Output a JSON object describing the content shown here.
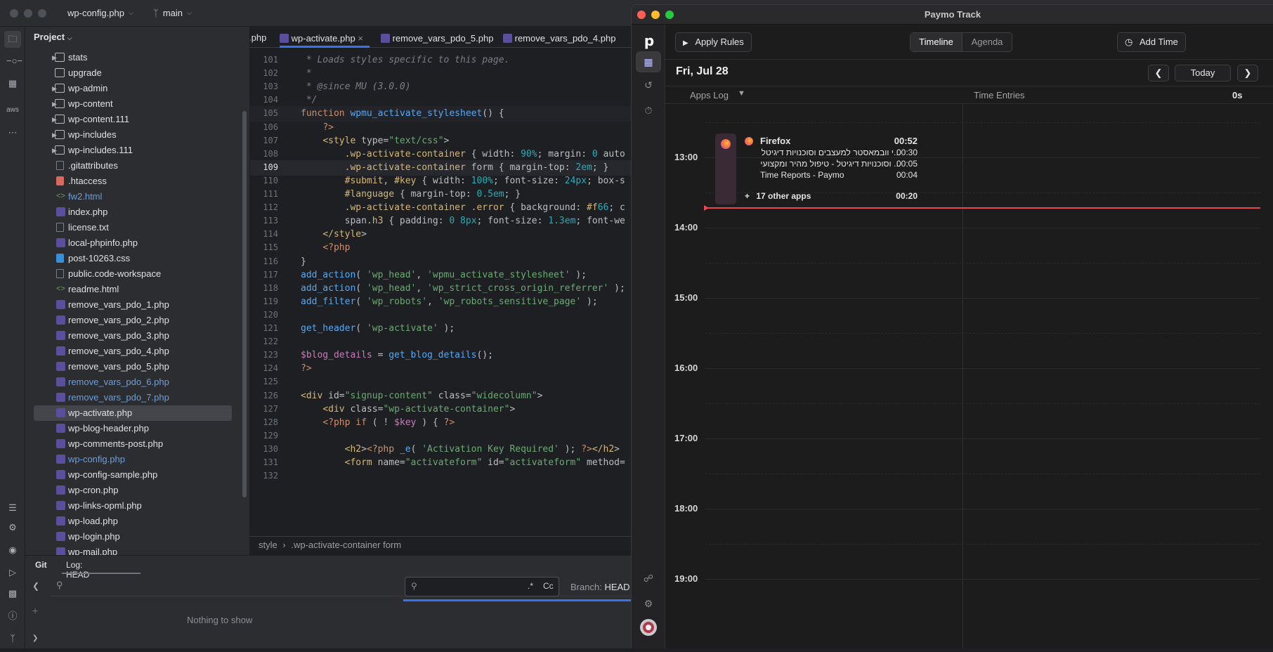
{
  "ide": {
    "window": {
      "file_title": "wp-config.php",
      "branch": "main"
    },
    "project_panel": {
      "title": "Project",
      "items": [
        {
          "label": "stats",
          "type": "folder",
          "expandable": true,
          "color": "normal"
        },
        {
          "label": "upgrade",
          "type": "folder",
          "expandable": false,
          "color": "normal"
        },
        {
          "label": "wp-admin",
          "type": "folder",
          "expandable": true,
          "color": "normal"
        },
        {
          "label": "wp-content",
          "type": "folder",
          "expandable": true,
          "color": "normal"
        },
        {
          "label": "wp-content.111",
          "type": "folder",
          "expandable": true,
          "color": "normal"
        },
        {
          "label": "wp-includes",
          "type": "folder",
          "expandable": true,
          "color": "normal"
        },
        {
          "label": "wp-includes.111",
          "type": "folder",
          "expandable": true,
          "color": "normal"
        },
        {
          "label": ".gitattributes",
          "type": "file",
          "color": "normal"
        },
        {
          "label": ".htaccess",
          "type": "git",
          "color": "normal"
        },
        {
          "label": "fw2.html",
          "type": "html",
          "color": "modified"
        },
        {
          "label": "index.php",
          "type": "php",
          "color": "normal"
        },
        {
          "label": "license.txt",
          "type": "file",
          "color": "normal"
        },
        {
          "label": "local-phpinfo.php",
          "type": "php",
          "color": "normal"
        },
        {
          "label": "post-10263.css",
          "type": "css",
          "color": "normal"
        },
        {
          "label": "public.code-workspace",
          "type": "file",
          "color": "normal"
        },
        {
          "label": "readme.html",
          "type": "html",
          "color": "normal"
        },
        {
          "label": "remove_vars_pdo_1.php",
          "type": "php",
          "color": "normal"
        },
        {
          "label": "remove_vars_pdo_2.php",
          "type": "php",
          "color": "normal"
        },
        {
          "label": "remove_vars_pdo_3.php",
          "type": "php",
          "color": "normal"
        },
        {
          "label": "remove_vars_pdo_4.php",
          "type": "php",
          "color": "normal"
        },
        {
          "label": "remove_vars_pdo_5.php",
          "type": "php",
          "color": "normal"
        },
        {
          "label": "remove_vars_pdo_6.php",
          "type": "php",
          "color": "modified"
        },
        {
          "label": "remove_vars_pdo_7.php",
          "type": "php",
          "color": "modified"
        },
        {
          "label": "wp-activate.php",
          "type": "php",
          "color": "normal",
          "selected": true
        },
        {
          "label": "wp-blog-header.php",
          "type": "php",
          "color": "normal"
        },
        {
          "label": "wp-comments-post.php",
          "type": "php",
          "color": "normal"
        },
        {
          "label": "wp-config.php",
          "type": "php",
          "color": "modified"
        },
        {
          "label": "wp-config-sample.php",
          "type": "php",
          "color": "normal"
        },
        {
          "label": "wp-cron.php",
          "type": "php",
          "color": "normal"
        },
        {
          "label": "wp-links-opml.php",
          "type": "php",
          "color": "normal"
        },
        {
          "label": "wp-load.php",
          "type": "php",
          "color": "normal"
        },
        {
          "label": "wp-login.php",
          "type": "php",
          "color": "normal"
        },
        {
          "label": "wp-mail.php",
          "type": "php",
          "color": "normal"
        }
      ]
    },
    "editor": {
      "tabs": [
        ".php",
        "wp-activate.php",
        "remove_vars_pdo_5.php",
        "remove_vars_pdo_4.php"
      ],
      "active_tab": "wp-activate.php",
      "current_line": 109,
      "lines": [
        {
          "n": 101,
          "t": " * Loads styles specific to this page."
        },
        {
          "n": 102,
          "t": " *"
        },
        {
          "n": 103,
          "t": " * @since MU (3.0.0)"
        },
        {
          "n": 104,
          "t": " */"
        },
        {
          "n": 105,
          "t": "function wpmu_activate_stylesheet() {"
        },
        {
          "n": 106,
          "t": "    ?>"
        },
        {
          "n": 107,
          "t": "    <style type=\"text/css\">"
        },
        {
          "n": 108,
          "t": "        .wp-activate-container { width: 90%; margin: 0 auto"
        },
        {
          "n": 109,
          "t": "        .wp-activate-container form { margin-top: 2em; }"
        },
        {
          "n": 110,
          "t": "        #submit, #key { width: 100%; font-size: 24px; box-s"
        },
        {
          "n": 111,
          "t": "        #language { margin-top: 0.5em; }"
        },
        {
          "n": 112,
          "t": "        .wp-activate-container .error { background: #f66; c"
        },
        {
          "n": 113,
          "t": "        span.h3 { padding: 0 8px; font-size: 1.3em; font-we"
        },
        {
          "n": 114,
          "t": "    </style>"
        },
        {
          "n": 115,
          "t": "    <?php"
        },
        {
          "n": 116,
          "t": "}"
        },
        {
          "n": 117,
          "t": "add_action( 'wp_head', 'wpmu_activate_stylesheet' );"
        },
        {
          "n": 118,
          "t": "add_action( 'wp_head', 'wp_strict_cross_origin_referrer' );"
        },
        {
          "n": 119,
          "t": "add_filter( 'wp_robots', 'wp_robots_sensitive_page' );"
        },
        {
          "n": 120,
          "t": ""
        },
        {
          "n": 121,
          "t": "get_header( 'wp-activate' );"
        },
        {
          "n": 122,
          "t": ""
        },
        {
          "n": 123,
          "t": "$blog_details = get_blog_details();"
        },
        {
          "n": 124,
          "t": "?>"
        },
        {
          "n": 125,
          "t": ""
        },
        {
          "n": 126,
          "t": "<div id=\"signup-content\" class=\"widecolumn\">"
        },
        {
          "n": 127,
          "t": "    <div class=\"wp-activate-container\">"
        },
        {
          "n": 128,
          "t": "    <?php if ( ! $key ) { ?>"
        },
        {
          "n": 129,
          "t": ""
        },
        {
          "n": 130,
          "t": "        <h2><?php _e( 'Activation Key Required' ); ?></h2>"
        },
        {
          "n": 131,
          "t": "        <form name=\"activateform\" id=\"activateform\" method="
        },
        {
          "n": 132,
          "t": ""
        }
      ],
      "breadcrumb": [
        "style",
        ".wp-activate-container form"
      ]
    },
    "bottom_panel": {
      "tab_git": "Git",
      "tab_log": "Log: HEAD",
      "empty_text": "Nothing to show",
      "regex_label": ".*",
      "case_label": "Cc",
      "branch_label": "Branch:",
      "branch_value": "HEAD"
    }
  },
  "paymo": {
    "window_title": "Paymo Track",
    "toolbar": {
      "apply_rules": "Apply Rules",
      "timeline": "Timeline",
      "agenda": "Agenda",
      "add_time": "Add Time"
    },
    "date": "Fri, Jul 28",
    "today": "Today",
    "columns": {
      "apps_log": "Apps Log",
      "time_entries": "Time Entries",
      "total": "0s"
    },
    "hours": [
      "13:00",
      "14:00",
      "15:00",
      "16:00",
      "17:00",
      "18:00",
      "19:00"
    ],
    "apps": {
      "app_name": "Firefox",
      "app_duration": "00:52",
      "entries": [
        {
          "title": "...י וובמאסטר למעצבים וסוכנויות דיגיטל",
          "duration": "00:30"
        },
        {
          "title": "... וסוכנויות דיגיטל - טיפול מהיר ומקצועי",
          "duration": "00:05"
        },
        {
          "title": "Time Reports - Paymo",
          "duration": "00:04"
        }
      ],
      "other_apps": "17 other apps",
      "other_duration": "00:20"
    },
    "colors": {
      "now_line": "#e5484d",
      "accent": "#3574f0"
    }
  }
}
